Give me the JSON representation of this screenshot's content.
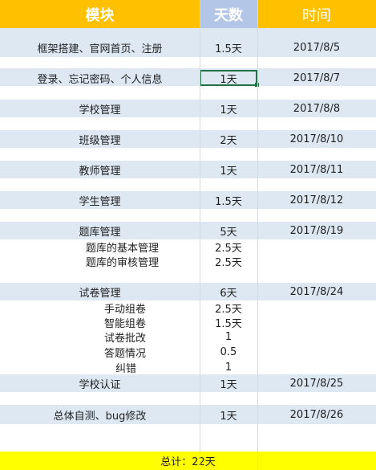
{
  "header": {
    "col_module": "模块",
    "col_days": "天数",
    "col_date": "时间"
  },
  "rows": [
    {
      "module": "框架搭建、官网首页、注册",
      "days": "1.5天",
      "date": "2017/8/5"
    },
    {
      "module": "登录、忘记密码、个人信息",
      "days": "1天",
      "date": "2017/8/7"
    },
    {
      "module": "学校管理",
      "days": "1天",
      "date": "2017/8/8"
    },
    {
      "module": "班级管理",
      "days": "2天",
      "date": "2017/8/10"
    },
    {
      "module": "教师管理",
      "days": "1天",
      "date": "2017/8/11"
    },
    {
      "module": "学生管理",
      "days": "1.5天",
      "date": "2017/8/12"
    },
    {
      "module": "题库管理",
      "days": "5天",
      "date": "2017/8/19"
    },
    {
      "module": "题库的基本管理",
      "days": "2.5天",
      "date": ""
    },
    {
      "module": "题库的审核管理",
      "days": "2.5天",
      "date": ""
    },
    {
      "module": "试卷管理",
      "days": "6天",
      "date": "2017/8/24"
    },
    {
      "module": "手动组卷",
      "days": "2.5天",
      "date": ""
    },
    {
      "module": "智能组卷",
      "days": "1.5天",
      "date": ""
    },
    {
      "module": "试卷批改",
      "days": "1",
      "date": ""
    },
    {
      "module": "答题情况",
      "days": "0.5",
      "date": ""
    },
    {
      "module": "纠错",
      "days": "1",
      "date": ""
    },
    {
      "module": "学校认证",
      "days": "1天",
      "date": "2017/8/25"
    },
    {
      "module": "总体自测、bug修改",
      "days": "1天",
      "date": "2017/8/26"
    }
  ],
  "total": "总计：22天"
}
